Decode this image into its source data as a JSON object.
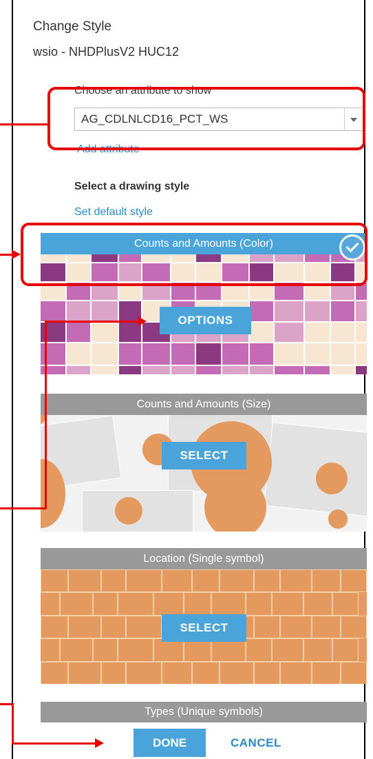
{
  "panel": {
    "title": "Change Style",
    "layer_name": "wsio - NHDPlusV2 HUC12",
    "attribute_label": "Choose an attribute to show",
    "attribute_value": "AG_CDLNLCD16_PCT_WS",
    "add_attribute": "Add attribute",
    "drawing_style_label": "Select a drawing style",
    "set_default_style": "Set default style"
  },
  "styles": [
    {
      "name": "Counts and Amounts (Color)",
      "button": "OPTIONS",
      "selected": true
    },
    {
      "name": "Counts and Amounts (Size)",
      "button": "SELECT",
      "selected": false
    },
    {
      "name": "Location (Single symbol)",
      "button": "SELECT",
      "selected": false
    },
    {
      "name": "Types (Unique symbols)",
      "button": "",
      "selected": false
    }
  ],
  "footer": {
    "done": "DONE",
    "cancel": "CANCEL"
  },
  "colors": {
    "accent_blue": "#4aa3d9",
    "link_blue": "#2c8ac8",
    "highlight_red": "#e60000",
    "orange_symbol": "#e49a5e",
    "purple_dark": "#8b3a82",
    "purple_mid": "#c46bb5",
    "purple_light": "#dca3c9",
    "cream": "#f7e6d1"
  }
}
